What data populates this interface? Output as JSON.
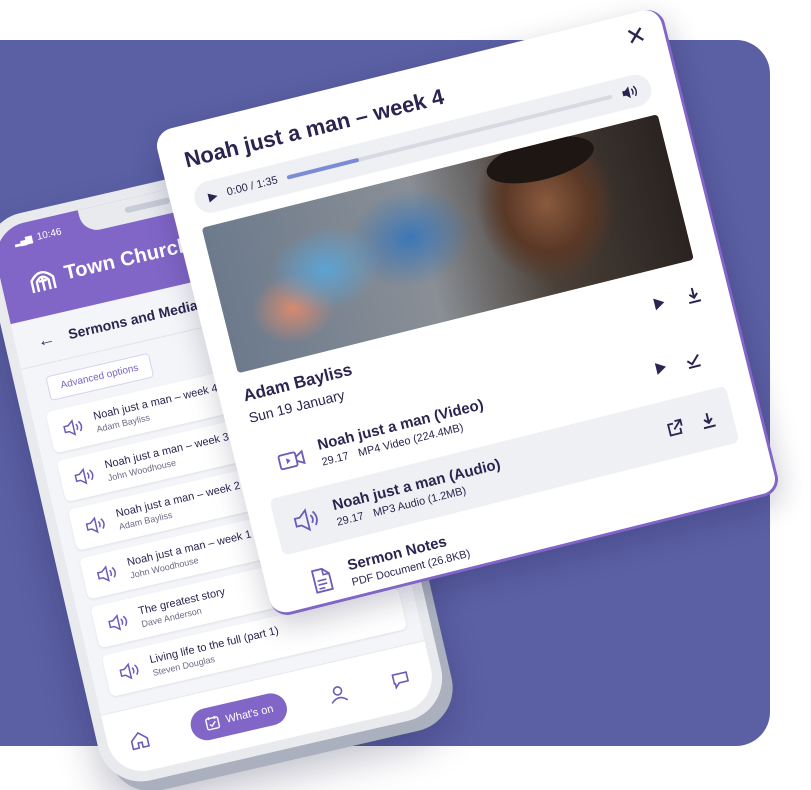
{
  "phone": {
    "status_time": "10:46",
    "app_name": "Town Church",
    "section_title": "Sermons and Media",
    "advanced_options": "Advanced options",
    "sermons": [
      {
        "title": "Noah just a man – week 4",
        "speaker": "Adam Bayliss"
      },
      {
        "title": "Noah just a man – week 3",
        "speaker": "John Woodhouse"
      },
      {
        "title": "Noah just a man – week 2",
        "speaker": "Adam Bayliss"
      },
      {
        "title": "Noah just a man – week 1",
        "speaker": "John Woodhouse"
      },
      {
        "title": "The greatest story",
        "speaker": "Dave Anderson"
      },
      {
        "title": "Living life to the full (part 1)",
        "speaker": "Steven Douglas"
      }
    ],
    "nav": {
      "whats_on": "What's on"
    }
  },
  "card": {
    "title": "Noah just a man – week 4",
    "player": {
      "time": "0:00 / 1:35",
      "progress": 0.22
    },
    "speaker": {
      "name": "Adam Bayliss",
      "date": "Sun 19 January"
    },
    "media": [
      {
        "title": "Noah just a man (Video)",
        "duration": "29.17",
        "meta": "MP4 Video (224.4MB)"
      },
      {
        "title": "Noah just a man (Audio)",
        "duration": "29.17",
        "meta": "MP3 Audio (1.2MB)"
      },
      {
        "title": "Sermon Notes",
        "duration": "",
        "meta": "PDF Document (26.8KB)"
      }
    ]
  },
  "colors": {
    "accent": "#8166c7",
    "background_panel": "#5b5fa4",
    "text": "#2b2350"
  }
}
